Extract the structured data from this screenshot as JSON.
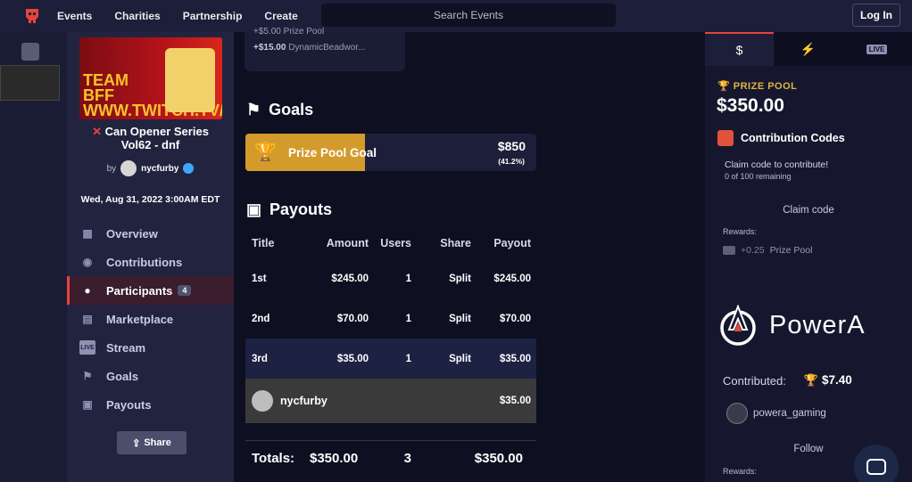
{
  "topbar": {
    "nav": [
      "Events",
      "Charities",
      "Partnership",
      "Create"
    ],
    "search_placeholder": "Search Events",
    "login": "Log In"
  },
  "sidebar": {
    "banner_text": "TEAM BFF WWW.TWITCH.TV/ IFCYIPES",
    "event_title": "Can Opener Series Vol62 - dnf",
    "by": "by",
    "user": "nycfurby",
    "date": "Wed, Aug 31, 2022 3:00AM EDT",
    "menu": [
      {
        "label": "Overview",
        "icon": "grid-icon"
      },
      {
        "label": "Contributions",
        "icon": "coins-icon"
      },
      {
        "label": "Participants",
        "icon": "users-icon",
        "badge": "4"
      },
      {
        "label": "Marketplace",
        "icon": "store-icon"
      },
      {
        "label": "Stream",
        "icon": "live-icon"
      },
      {
        "label": "Goals",
        "icon": "flag-icon"
      },
      {
        "label": "Payouts",
        "icon": "money-icon"
      }
    ],
    "share": "Share"
  },
  "main": {
    "prev_line1": "+$5.00 Prize Pool",
    "prev_line2_amount": "+$15.00",
    "prev_line2_user": "DynamicBeadwor...",
    "goals_title": "Goals",
    "goal": {
      "label": "Prize Pool Goal",
      "amount": "$850",
      "percent": "(41.2%)",
      "progress": 0.412
    },
    "payouts_title": "Payouts",
    "headers": [
      "Title",
      "Amount",
      "Users",
      "Share",
      "Payout"
    ],
    "rows": [
      {
        "title": "1st",
        "amount": "$245.00",
        "users": "1",
        "share": "Split",
        "payout": "$245.00"
      },
      {
        "title": "2nd",
        "amount": "$70.00",
        "users": "1",
        "share": "Split",
        "payout": "$70.00"
      },
      {
        "title": "3rd",
        "amount": "$35.00",
        "users": "1",
        "share": "Split",
        "payout": "$35.00"
      }
    ],
    "winner": {
      "name": "nycfurby",
      "payout": "$35.00"
    },
    "totals": {
      "label": "Totals:",
      "amount": "$350.00",
      "users": "3",
      "payout": "$350.00"
    }
  },
  "right": {
    "prize_pool_label": "PRIZE POOL",
    "prize_pool_value": "$350.00",
    "contribution_codes": "Contribution Codes",
    "claim_text": "Claim code to contribute!",
    "claim_remaining": "0 of 100 remaining",
    "claim_code": "Claim code",
    "rewards_label": "Rewards:",
    "reward_amount": "+0.25",
    "reward_text": "Prize Pool",
    "sponsor": "PowerA",
    "contributed_label": "Contributed:",
    "contributed_value": "$7.40",
    "sponsor_user": "powera_gaming",
    "follow": "Follow",
    "rewards_label2": "Rewards:"
  }
}
